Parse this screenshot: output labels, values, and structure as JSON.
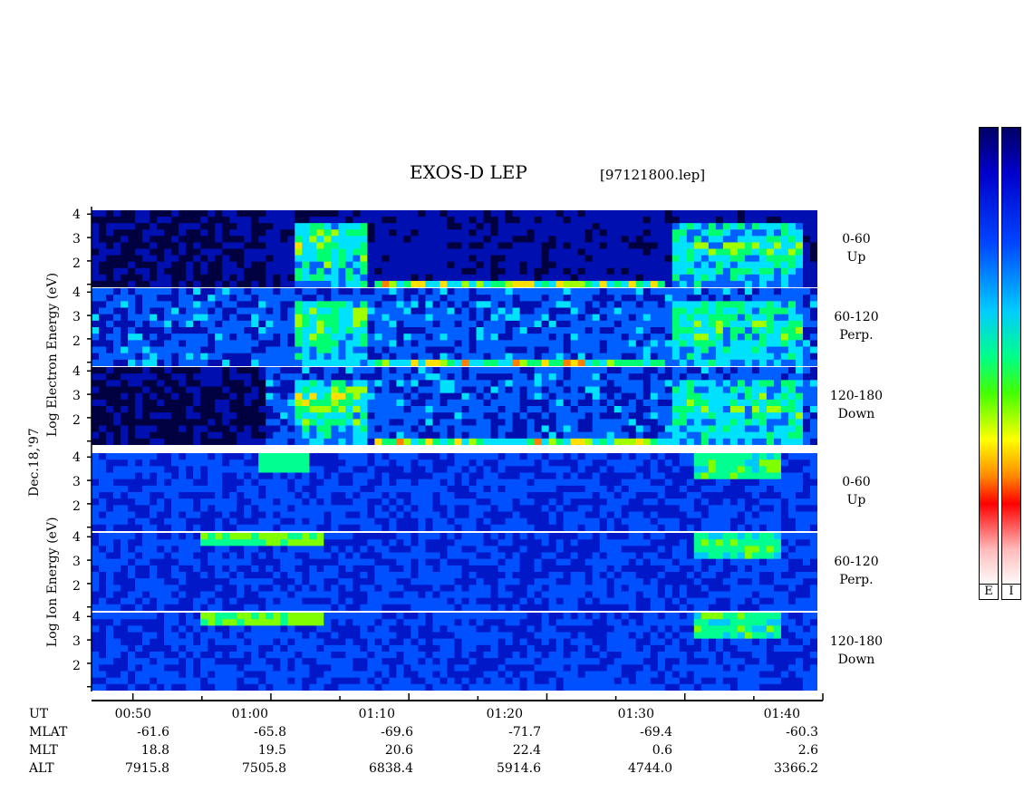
{
  "chart_data": {
    "type": "heatmap",
    "title": "EXOS-D LEP",
    "file_label": "[97121800.lep]",
    "date_label": "Dec.18,'97",
    "yticks": [
      "4",
      "3",
      "2"
    ],
    "electron_ylabel": "Log Electron Energy (eV)",
    "ion_ylabel": "Log Ion Energy (eV)",
    "panels": [
      {
        "species": "electron",
        "line1": "0-60",
        "line2": "Up"
      },
      {
        "species": "electron",
        "line1": "60-120",
        "line2": "Perp."
      },
      {
        "species": "electron",
        "line1": "120-180",
        "line2": "Down"
      },
      {
        "species": "ion",
        "line1": "0-60",
        "line2": "Up"
      },
      {
        "species": "ion",
        "line1": "60-120",
        "line2": "Perp."
      },
      {
        "species": "ion",
        "line1": "120-180",
        "line2": "Down"
      }
    ],
    "x_rows": [
      {
        "name": "UT",
        "values": [
          "00:50",
          "01:00",
          "01:10",
          "01:20",
          "01:30",
          "01:40"
        ]
      },
      {
        "name": "MLAT",
        "values": [
          "-61.6",
          "-65.8",
          "-69.6",
          "-71.7",
          "-69.4",
          "-60.3"
        ]
      },
      {
        "name": "MLT",
        "values": [
          "18.8",
          "19.5",
          "20.6",
          "22.4",
          "0.6",
          "2.6"
        ]
      },
      {
        "name": "ALT",
        "values": [
          "7915.8",
          "7505.8",
          "6838.4",
          "5914.6",
          "4744.0",
          "3366.2"
        ]
      }
    ],
    "colorbar_labels": [
      "E",
      "I"
    ],
    "colors": {
      "low": "#0000cc",
      "mid": "#00ff88",
      "high": "#ff0000"
    }
  }
}
